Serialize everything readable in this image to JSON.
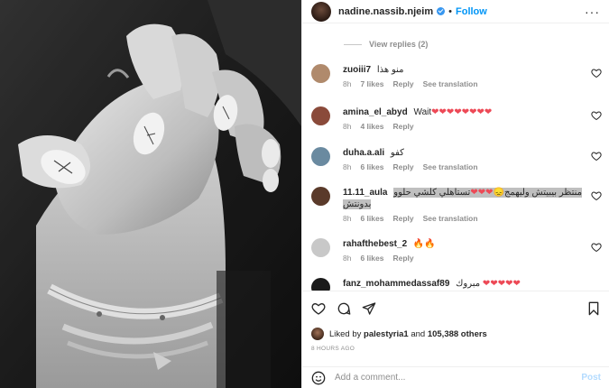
{
  "post": {
    "username": "nadine.nassib.njeim",
    "separator": "•",
    "follow_label": "Follow",
    "more_label": "···"
  },
  "view_replies": "View replies (2)",
  "comments": [
    {
      "username": "zuoiii7",
      "text": "منو هذا",
      "time": "8h",
      "likes": "7 likes",
      "reply": "Reply",
      "translate": "See translation",
      "avatar_color": "#b08a6c"
    },
    {
      "username": "amina_el_abyd",
      "text": "Wait❤❤❤❤❤❤❤❤",
      "time": "8h",
      "likes": "4 likes",
      "reply": "Reply",
      "translate": "",
      "avatar_color": "#8a4a3a"
    },
    {
      "username": "duha.a.ali",
      "text": "كفو",
      "time": "8h",
      "likes": "6 likes",
      "reply": "Reply",
      "translate": "See translation",
      "avatar_color": "#6a8aa0"
    },
    {
      "username": "11.11_aula",
      "text": "منتظر بيبيتش وليهمج😞❤❤❤تستاهلي كلشي حلوو بدونتش",
      "time": "8h",
      "likes": "6 likes",
      "reply": "Reply",
      "translate": "See translation",
      "avatar_color": "#5a3a2a"
    },
    {
      "username": "rahafthebest_2",
      "text": "🔥🔥",
      "time": "8h",
      "likes": "6 likes",
      "reply": "Reply",
      "translate": "",
      "avatar_color": "#c8c8c8"
    },
    {
      "username": "fanz_mohammedassaf89",
      "text": "مبروك ❤❤❤❤❤",
      "time": "",
      "likes": "",
      "reply": "",
      "translate": "",
      "avatar_color": "#1a1a1a"
    }
  ],
  "likes": {
    "liked_by_prefix": "Liked by",
    "liked_by_user": "palestyria1",
    "and": "and",
    "count": "105,388 others"
  },
  "time_ago": "8 HOURS AGO",
  "add_comment": {
    "placeholder": "Add a comment...",
    "post_label": "Post"
  },
  "icons": [
    "heart-icon",
    "comment-icon",
    "share-icon",
    "bookmark-icon",
    "emoji-icon",
    "more-icon",
    "verified-icon"
  ],
  "colors": {
    "link": "#0095f6",
    "verified": "#3897f0",
    "muted": "#8e8e8e",
    "post_disabled": "#b3dbff",
    "heart": "#ed4956"
  }
}
